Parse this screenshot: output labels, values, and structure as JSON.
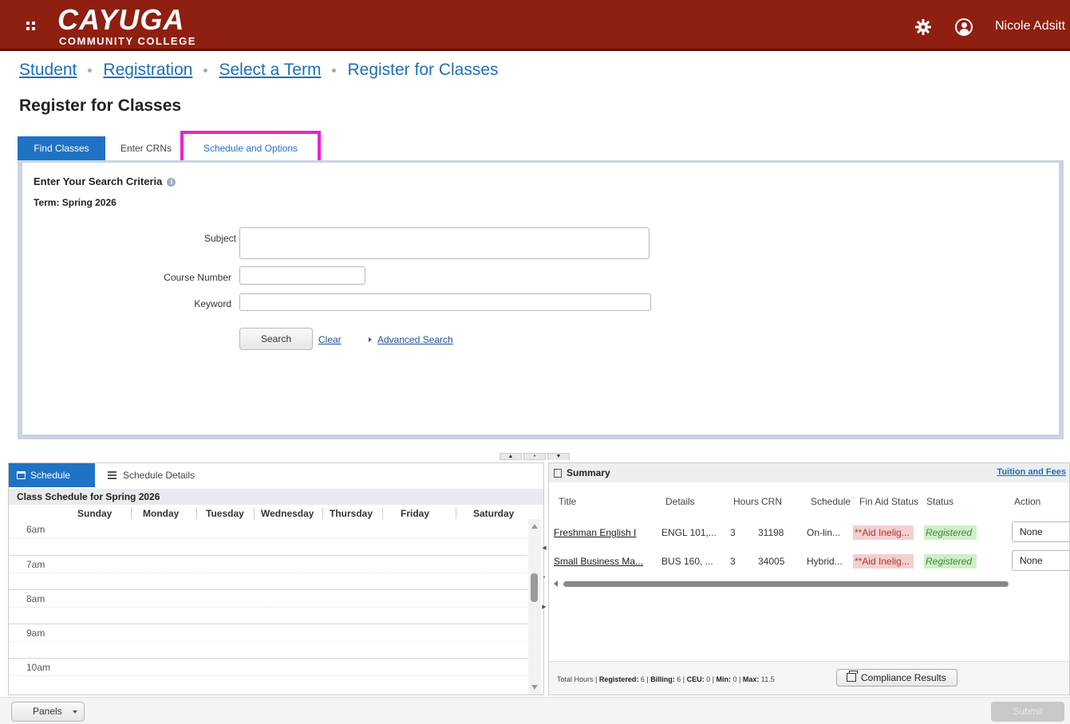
{
  "header": {
    "logo_main": "CAYUGA",
    "logo_sub": "COMMUNITY COLLEGE",
    "user_name": "Nicole Adsitt"
  },
  "breadcrumb": [
    "Student",
    "Registration",
    "Select a Term",
    "Register for Classes"
  ],
  "page_title": "Register for Classes",
  "tabs": [
    {
      "label": "Find Classes",
      "active": true
    },
    {
      "label": "Enter CRNs",
      "active": false
    },
    {
      "label": "Schedule and Options",
      "active": false
    }
  ],
  "highlight_color": "#ee1fd4",
  "accent_color": "#1f72c4",
  "header_color": "#8f1f10",
  "search": {
    "title": "Enter Your Search Criteria",
    "term": "Term: Spring 2026",
    "subject_label": "Subject",
    "subject_value": "",
    "course_number_label": "Course Number",
    "course_number_value": "",
    "keyword_label": "Keyword",
    "keyword_value": "",
    "search_button": "Search",
    "clear_link": "Clear",
    "advanced_link": "Advanced Search"
  },
  "schedule": {
    "tab_schedule": "Schedule",
    "tab_details": "Schedule Details",
    "header": "Class Schedule for Spring 2026",
    "days": [
      "Sunday",
      "Monday",
      "Tuesday",
      "Wednesday",
      "Thursday",
      "Friday",
      "Saturday"
    ],
    "hours": [
      "6am",
      "7am",
      "8am",
      "9am",
      "10am"
    ]
  },
  "summary": {
    "title": "Summary",
    "tuition_link": "Tuition and Fees",
    "columns": [
      "Title",
      "Details",
      "Hours",
      "CRN",
      "Schedule Type",
      "Fin Aid Status",
      "Status",
      "Action"
    ],
    "rows": [
      {
        "title": "Freshman English I",
        "details": "ENGL 101,...",
        "hours": "3",
        "crn": "31198",
        "schedule": "On-lin...",
        "aid": "**Aid Inelig...",
        "status": "Registered",
        "action": "None"
      },
      {
        "title": "Small Business Ma...",
        "details": "BUS 160, ...",
        "hours": "3",
        "crn": "34005",
        "schedule": "Hybrid...",
        "aid": "**Aid Inelig...",
        "status": "Registered",
        "action": "None"
      }
    ],
    "totals": {
      "prefix": "Total Hours |",
      "registered_label": "Registered:",
      "registered": "6",
      "billing_label": "Billing:",
      "billing": "6",
      "ceu_label": "CEU:",
      "ceu": "0",
      "min_label": "Min:",
      "min": "0",
      "max_label": "Max:",
      "max": "11.5"
    },
    "compliance_button": "Compliance Results"
  },
  "bottom": {
    "panels_button": "Panels",
    "submit_button": "Submit"
  }
}
